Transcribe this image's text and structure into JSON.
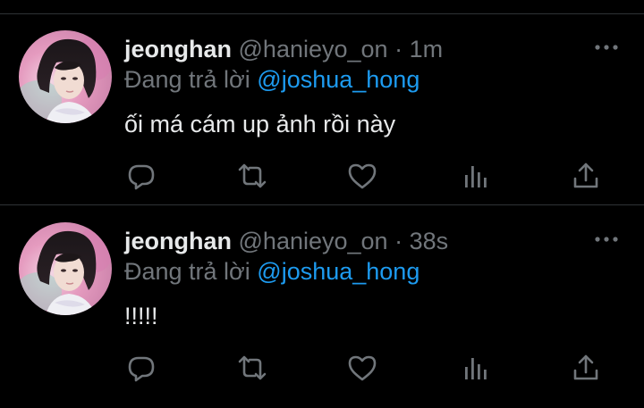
{
  "colors": {
    "background": "#000000",
    "text_primary": "#e7e9ea",
    "text_secondary": "#71767b",
    "accent": "#1d9bf0",
    "divider": "#2f3336"
  },
  "tweets": [
    {
      "display_name": "jeonghan",
      "handle": "@hanieyo_on",
      "separator": "·",
      "time": "1m",
      "reply_prefix": "Đang trả lời",
      "reply_to": "@joshua_hong",
      "text": "ối má cám up ảnh rồi này",
      "icons": [
        "more-icon",
        "reply-icon",
        "retweet-icon",
        "like-icon",
        "stats-icon",
        "share-icon"
      ]
    },
    {
      "display_name": "jeonghan",
      "handle": "@hanieyo_on",
      "separator": "·",
      "time": "38s",
      "reply_prefix": "Đang trả lời",
      "reply_to": "@joshua_hong",
      "text": "!!!!!",
      "icons": [
        "more-icon",
        "reply-icon",
        "retweet-icon",
        "like-icon",
        "stats-icon",
        "share-icon"
      ]
    }
  ]
}
